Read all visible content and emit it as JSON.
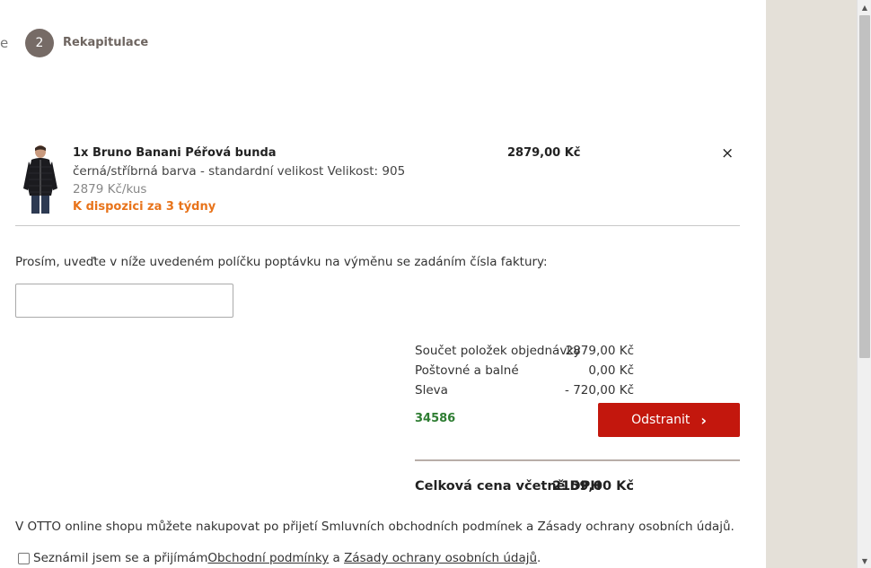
{
  "steps": {
    "prev_fragment": "e",
    "current_number": "2",
    "current_label": "Rekapitulace"
  },
  "product": {
    "name": "1x Bruno Banani Péřová bunda",
    "variant": "černá/stříbrná barva - standardní velikost Velikost: 905",
    "unit_price": "2879 Kč/kus",
    "availability": "K dispozici za 3 týdny",
    "price": "2879,00 Kč",
    "remove_glyph": "×",
    "colors": {
      "availability": "#e8731a"
    }
  },
  "exchange": {
    "prompt": "Prosím, uveďte v níže uvedeném políčku poptávku na výměnu se zadáním čísla faktury:",
    "input_value": ""
  },
  "summary": {
    "rows": [
      {
        "label": "Součet položek objednávky",
        "value": "2879,00 Kč"
      },
      {
        "label": "Poštovné a balné",
        "value": "0,00 Kč"
      },
      {
        "label": "Sleva",
        "value": "- 720,00 Kč"
      }
    ],
    "voucher_code": "34586",
    "remove_button": "Odstranit",
    "total_label": "Celková cena včetně DPH",
    "total_value": "2159,00 Kč",
    "colors": {
      "button": "#c3170d",
      "code": "#2e7d32"
    }
  },
  "terms": {
    "note": "V OTTO online shopu můžete nakupovat po přijetí Smluvních obchodních podmínek a Zásady ochrany osobních údajů.",
    "checkbox_prefix": "Seznámil jsem se a přijímám ",
    "link1": "Obchodní podmínky",
    "conjunction": " a ",
    "link2": "Zásady ochrany osobních údajů",
    "suffix": ".",
    "checked": false
  }
}
